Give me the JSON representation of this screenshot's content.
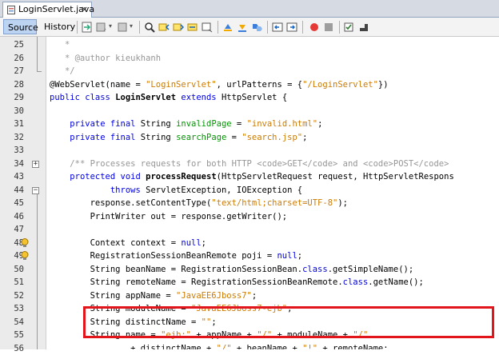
{
  "tab": {
    "filename": "LoginServlet.java",
    "close": "×"
  },
  "toolbar": {
    "source_label": "Source",
    "history_label": "History"
  },
  "icons": [
    "toolbar-icon-history",
    "toolbar-icon-back",
    "toolbar-icon-forward",
    "search-icon",
    "find-prev-icon",
    "find-next-icon",
    "toggle-highlight-icon",
    "toggle-rect-icon",
    "prev-bookmark-icon",
    "next-bookmark-icon",
    "toggle-bookmark-icon",
    "shift-left-icon",
    "shift-right-icon",
    "start-macro-icon",
    "stop-macro-icon",
    "comment-icon",
    "uncomment-icon"
  ],
  "colors": {
    "keyword": "#0000e6",
    "string": "#ce7b00",
    "comment": "#969696",
    "field": "#009900",
    "highlight_box": "#e2161a"
  },
  "lines": [
    {
      "n": "25",
      "html": "   <span class=\"c\">*</span>"
    },
    {
      "n": "26",
      "html": "   <span class=\"c\">* @author kieukhanh</span>"
    },
    {
      "n": "27",
      "html": "   <span class=\"c\">*/</span>"
    },
    {
      "n": "28",
      "html": "@WebServlet(name = <span class=\"s\">\"LoginServlet\"</span>, urlPatterns = {<span class=\"s\">\"/LoginServlet\"</span>})"
    },
    {
      "n": "29",
      "html": "<span class=\"k\">public class</span> <span class=\"b\">LoginServlet</span> <span class=\"k\">extends</span> HttpServlet {"
    },
    {
      "n": "30",
      "html": ""
    },
    {
      "n": "31",
      "html": "    <span class=\"k\">private final</span> String <span class=\"f\">invalidPage</span> = <span class=\"s\">\"invalid.html\"</span>;"
    },
    {
      "n": "32",
      "html": "    <span class=\"k\">private final</span> String <span class=\"f\">searchPage</span> = <span class=\"s\">\"search.jsp\"</span>;"
    },
    {
      "n": "33",
      "html": ""
    },
    {
      "n": "34",
      "html": "    <span class=\"c\">/** Processes requests for both HTTP &lt;code&gt;GET&lt;/code&gt; and &lt;code&gt;POST&lt;/code&gt;</span>"
    },
    {
      "n": "43",
      "html": "    <span class=\"k\">protected void</span> <span class=\"b\">processRequest</span>(HttpServletRequest request, HttpServletRespons"
    },
    {
      "n": "44",
      "html": "            <span class=\"k\">throws</span> ServletException, IOException {"
    },
    {
      "n": "45",
      "html": "        response.setContentType(<span class=\"s\">\"text/html;charset=UTF-8\"</span>);"
    },
    {
      "n": "46",
      "html": "        PrintWriter out = response.getWriter();"
    },
    {
      "n": "47",
      "html": ""
    },
    {
      "n": "48",
      "html": "        Context context = <span class=\"k\">null</span>;"
    },
    {
      "n": "49",
      "html": "        RegistrationSessionBeanRemote poji = <span class=\"k\">null</span>;"
    },
    {
      "n": "50",
      "html": "        String beanName = RegistrationSessionBean.<span class=\"k\">class</span>.getSimpleName();"
    },
    {
      "n": "51",
      "html": "        String remoteName = RegistrationSessionBeanRemote.<span class=\"k\">class</span>.getName();"
    },
    {
      "n": "52",
      "html": "        String appName = <span class=\"s\">\"JavaEE6Jboss7\"</span>;"
    },
    {
      "n": "53",
      "html": "        String moduleName = <span class=\"s\">\"JavaEE6Jboss7-ejb\"</span>;"
    },
    {
      "n": "54",
      "html": "        String distinctName = <span class=\"s\">\"\"</span>;"
    },
    {
      "n": "55",
      "html": "        String name = <span class=\"s\">\"ejb:\"</span> + appName + <span class=\"s\">\"/\"</span> + moduleName + <span class=\"s\">\"/\"</span>"
    },
    {
      "n": "56",
      "html": "                + distinctName + <span class=\"s\">\"/\"</span> + beanName + <span class=\"s\">\"!\"</span> + remoteName;"
    }
  ]
}
